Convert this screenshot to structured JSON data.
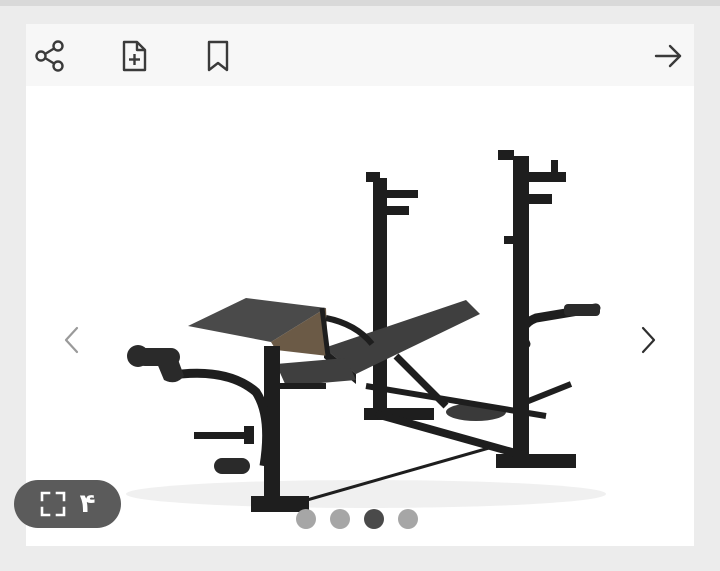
{
  "toolbar": {
    "share_icon": "share-icon",
    "add_to_list_icon": "file-plus-icon",
    "bookmark_icon": "bookmark-icon",
    "back_icon": "arrow-right-icon"
  },
  "gallery": {
    "image_count": "۴",
    "expand_icon": "expand-icon",
    "slide_count": 4,
    "active_slide": 3
  },
  "colors": {
    "background": "#ececec",
    "card": "#f7f7f7",
    "dot_inactive": "#a6a6a6",
    "dot_active": "#4a4a4a",
    "gallery_button": "#5b5b5b"
  }
}
